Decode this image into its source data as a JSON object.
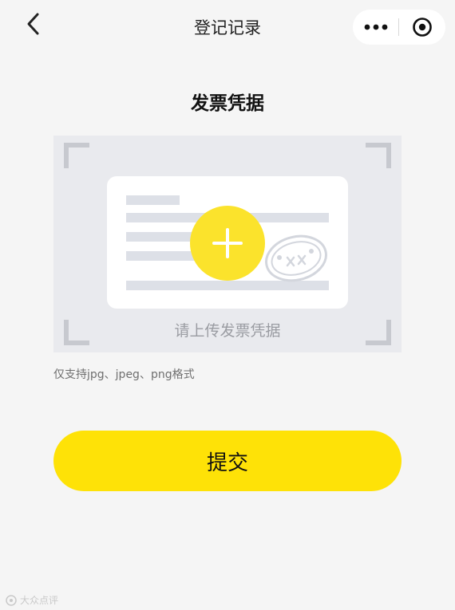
{
  "navbar": {
    "title": "登记记录",
    "back_icon": "chevron-left-icon",
    "more_icon": "more-dots-icon",
    "close_icon": "target-close-icon"
  },
  "section": {
    "title": "发票凭据"
  },
  "upload": {
    "hint": "请上传发票凭据",
    "plus_icon": "plus-icon",
    "format_note": "仅支持jpg、jpeg、png格式"
  },
  "submit": {
    "label": "提交"
  },
  "watermark": {
    "text": "大众点评"
  },
  "colors": {
    "accent": "#fee207",
    "background": "#f5f5f5",
    "upload_bg": "#e9eaee"
  }
}
